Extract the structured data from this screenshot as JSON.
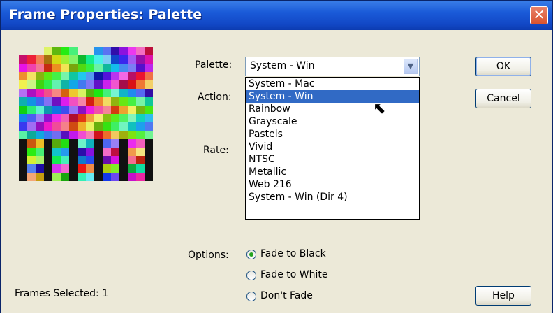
{
  "window": {
    "title": "Frame Properties: Palette",
    "close_glyph": "✕"
  },
  "labels": {
    "palette": "Palette:",
    "action": "Action:",
    "rate": "Rate:",
    "options": "Options:",
    "frames_selected": "Frames Selected: 1"
  },
  "palette_select": {
    "value": "System - Win",
    "arrow_icon": "chevron-down-icon",
    "options": [
      "System - Mac",
      "System - Win",
      "Rainbow",
      "Grayscale",
      "Pastels",
      "Vivid",
      "NTSC",
      "Metallic",
      "Web 216",
      "System - Win (Dir 4)"
    ],
    "highlighted_index": 1
  },
  "buttons": {
    "ok": "OK",
    "cancel": "Cancel",
    "help": "Help"
  },
  "options": {
    "items": [
      "Fade to Black",
      "Fade to White",
      "Don't Fade"
    ],
    "selected_index": 0
  },
  "colors": {
    "title_bar": "#1a5ad8",
    "highlight": "#316ac5",
    "dialog_bg": "#ece9d8",
    "radio_selected": "#25a321"
  }
}
